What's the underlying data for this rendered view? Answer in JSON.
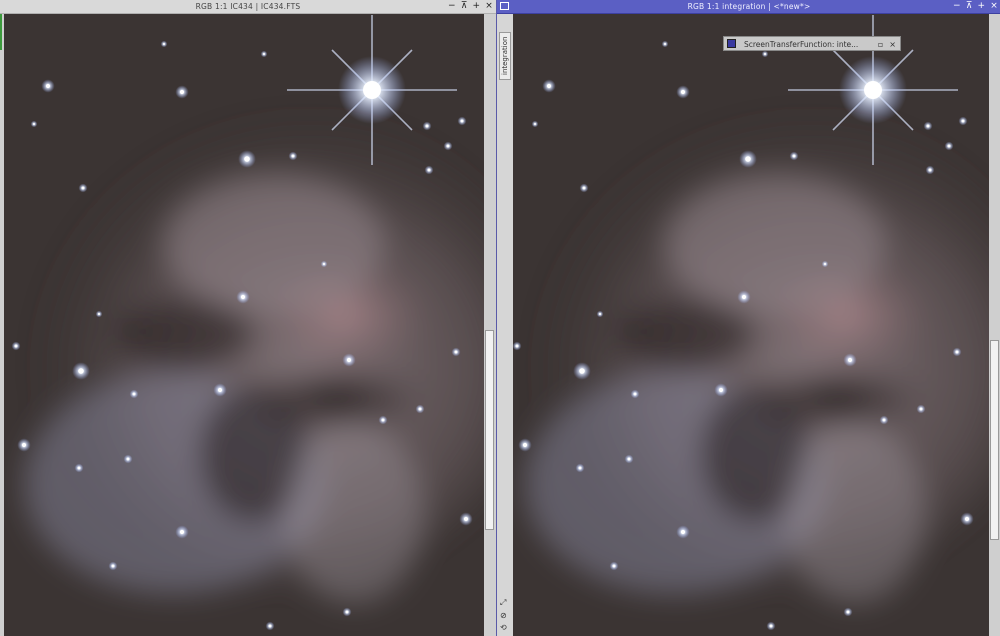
{
  "left_window": {
    "title": "RGB 1:1 IC434 | IC434.FTS",
    "buttons": [
      {
        "name": "minimize-button",
        "glyph": "−"
      },
      {
        "name": "shade-button",
        "glyph": "⊼"
      },
      {
        "name": "maximize-button",
        "glyph": "+"
      },
      {
        "name": "close-button",
        "glyph": "×"
      }
    ],
    "scroll_fraction": 0.52
  },
  "right_window": {
    "title": "RGB 1:1 integration | <*new*>",
    "side_tab_label": "integration",
    "side_tools": [
      "⤢",
      "⊘",
      "⟲"
    ],
    "buttons": [
      {
        "name": "minimize-button",
        "glyph": "−"
      },
      {
        "name": "shade-button",
        "glyph": "⊼"
      },
      {
        "name": "maximize-button",
        "glyph": "+"
      },
      {
        "name": "close-button",
        "glyph": "×"
      }
    ],
    "scroll_fraction": 0.46
  },
  "stf_popup": {
    "title": "ScreenTransferFunction: inte...",
    "buttons": [
      {
        "name": "float-button",
        "glyph": "▫"
      },
      {
        "name": "close-button",
        "glyph": "×"
      }
    ]
  },
  "image": {
    "description_icon": "nebula-image",
    "sky_color": "#3b3433",
    "nebula_color": "#8b7d82",
    "dust_color": "#1f1817"
  }
}
